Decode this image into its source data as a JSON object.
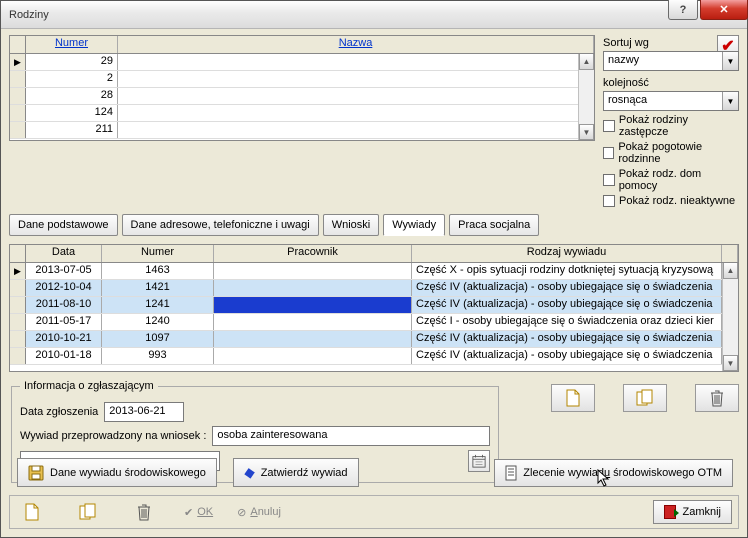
{
  "window": {
    "title": "Rodziny"
  },
  "topgrid": {
    "headers": {
      "numer": "Numer",
      "nazwa": "Nazwa"
    },
    "rows": [
      {
        "numer": "29",
        "nazwa": ""
      },
      {
        "numer": "2",
        "nazwa": ""
      },
      {
        "numer": "28",
        "nazwa": ""
      },
      {
        "numer": "124",
        "nazwa": ""
      },
      {
        "numer": "211",
        "nazwa": ""
      }
    ]
  },
  "sort": {
    "sortuj_label": "Sortuj wg",
    "sortuj_value": "nazwy",
    "kolej_label": "kolejność",
    "kolej_value": "rosnąca"
  },
  "checks": {
    "c1": "Pokaż rodziny zastępcze",
    "c2": "Pokaż pogotowie rodzinne",
    "c3": "Pokaż rodz. dom pomocy",
    "c4": "Pokaż rodz. nieaktywne"
  },
  "tabs": {
    "t1": "Dane podstawowe",
    "t2": "Dane adresowe, telefoniczne i uwagi",
    "t3": "Wnioski",
    "t4": "Wywiady",
    "t5": "Praca socjalna"
  },
  "midgrid": {
    "headers": {
      "data": "Data",
      "numer": "Numer",
      "pracownik": "Pracownik",
      "rodzaj": "Rodzaj wywiadu"
    },
    "rows": [
      {
        "data": "2013-07-05",
        "numer": "1463",
        "pracownik": "",
        "rodzaj": "Część X - opis sytuacji rodziny dotkniętej sytuacją kryzysową",
        "hl": false
      },
      {
        "data": "2012-10-04",
        "numer": "1421",
        "pracownik": "",
        "rodzaj": "Część IV (aktualizacja) - osoby ubiegające się o świadczenia",
        "hl": true
      },
      {
        "data": "2011-08-10",
        "numer": "1241",
        "pracownik": "",
        "rodzaj": "Część IV (aktualizacja) - osoby ubiegające się o świadczenia",
        "hl": true,
        "selected": true
      },
      {
        "data": "2011-05-17",
        "numer": "1240",
        "pracownik": "",
        "rodzaj": "Część I - osoby ubiegające się o świadczenia oraz dzieci kier",
        "hl": false
      },
      {
        "data": "2010-10-21",
        "numer": "1097",
        "pracownik": "",
        "rodzaj": "Część IV (aktualizacja) - osoby ubiegające się o świadczenia",
        "hl": true
      },
      {
        "data": "2010-01-18",
        "numer": "993",
        "pracownik": "",
        "rodzaj": "Część IV (aktualizacja) - osoby ubiegające się o świadczenia",
        "hl": false
      }
    ]
  },
  "info": {
    "legend": "Informacja o zgłaszającym",
    "data_label": "Data zgłoszenia",
    "data_value": "2013-06-21",
    "wniosek_label": "Wywiad przeprowadzony na wniosek :",
    "wniosek_value": "osoba zainteresowana"
  },
  "buttons": {
    "dane_wywiadu_pre": "Dane wywiadu środowiskowego",
    "zatwierdz": "Zatwierdź wywiad",
    "zlecenie_pre": "Zlecenie wywiad",
    "zlecenie_u": "u",
    "zlecenie_post": " środowiskowego OTM",
    "ok": "OK",
    "anuluj": "Anuluj",
    "zamknij_u": "Z",
    "zamknij_post": "amknij"
  }
}
